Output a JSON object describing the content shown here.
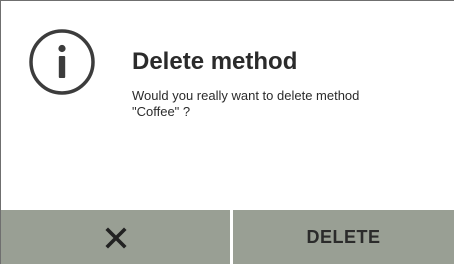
{
  "dialog": {
    "icon": "info-circle-icon",
    "title": "Delete method",
    "message_lines": [
      "Would you really want to delete method",
      "\"Coffee\" ?"
    ]
  },
  "buttons": {
    "cancel_icon": "close-icon",
    "delete_label": "DELETE"
  },
  "colors": {
    "button_background": "#999f94",
    "text": "#2b2b2b",
    "icon": "#3c3c3c",
    "background": "#ffffff"
  }
}
